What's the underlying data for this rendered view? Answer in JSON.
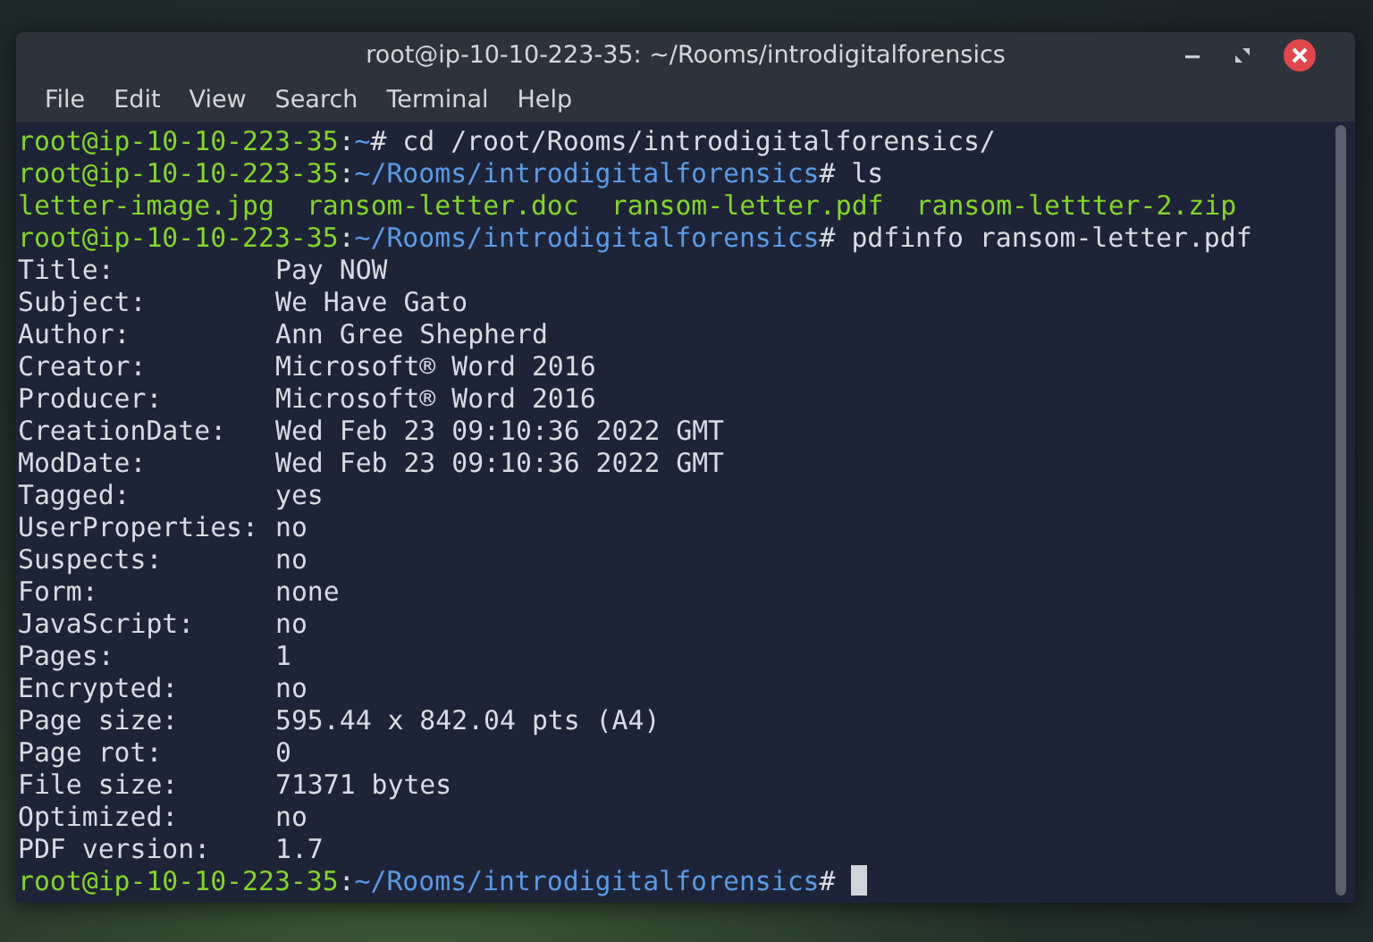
{
  "window": {
    "title": "root@ip-10-10-223-35: ~/Rooms/introdigitalforensics"
  },
  "menu": [
    "File",
    "Edit",
    "View",
    "Search",
    "Terminal",
    "Help"
  ],
  "lines": [
    {
      "kind": "prompt",
      "user": "root@ip-10-10-223-35",
      "colon": ":",
      "path": "~",
      "tail": "# cd /root/Rooms/introdigitalforensics/"
    },
    {
      "kind": "prompt",
      "user": "root@ip-10-10-223-35",
      "colon": ":",
      "path": "~/Rooms/introdigitalforensics",
      "tail": "# ls"
    },
    {
      "kind": "files",
      "files": [
        "letter-image.jpg",
        "ransom-letter.doc",
        "ransom-letter.pdf",
        "ransom-lettter-2.zip"
      ]
    },
    {
      "kind": "prompt",
      "user": "root@ip-10-10-223-35",
      "colon": ":",
      "path": "~/Rooms/introdigitalforensics",
      "tail": "# pdfinfo ransom-letter.pdf"
    },
    {
      "kind": "field",
      "label": "Title:",
      "value": "Pay NOW"
    },
    {
      "kind": "field",
      "label": "Subject:",
      "value": "We Have Gato"
    },
    {
      "kind": "field",
      "label": "Author:",
      "value": "Ann Gree Shepherd"
    },
    {
      "kind": "field",
      "label": "Creator:",
      "value": "Microsoft® Word 2016"
    },
    {
      "kind": "field",
      "label": "Producer:",
      "value": "Microsoft® Word 2016"
    },
    {
      "kind": "field",
      "label": "CreationDate:",
      "value": "Wed Feb 23 09:10:36 2022 GMT"
    },
    {
      "kind": "field",
      "label": "ModDate:",
      "value": "Wed Feb 23 09:10:36 2022 GMT"
    },
    {
      "kind": "field",
      "label": "Tagged:",
      "value": "yes"
    },
    {
      "kind": "field",
      "label": "UserProperties:",
      "value": "no"
    },
    {
      "kind": "field",
      "label": "Suspects:",
      "value": "no"
    },
    {
      "kind": "field",
      "label": "Form:",
      "value": "none"
    },
    {
      "kind": "field",
      "label": "JavaScript:",
      "value": "no"
    },
    {
      "kind": "field",
      "label": "Pages:",
      "value": "1"
    },
    {
      "kind": "field",
      "label": "Encrypted:",
      "value": "no"
    },
    {
      "kind": "field",
      "label": "Page size:",
      "value": "595.44 x 842.04 pts (A4)"
    },
    {
      "kind": "field",
      "label": "Page rot:",
      "value": "0"
    },
    {
      "kind": "field",
      "label": "File size:",
      "value": "71371 bytes"
    },
    {
      "kind": "field",
      "label": "Optimized:",
      "value": "no"
    },
    {
      "kind": "field",
      "label": "PDF version:",
      "value": "1.7"
    },
    {
      "kind": "prompt",
      "user": "root@ip-10-10-223-35",
      "colon": ":",
      "path": "~/Rooms/introdigitalforensics",
      "tail": "# ",
      "cursor": true
    }
  ]
}
